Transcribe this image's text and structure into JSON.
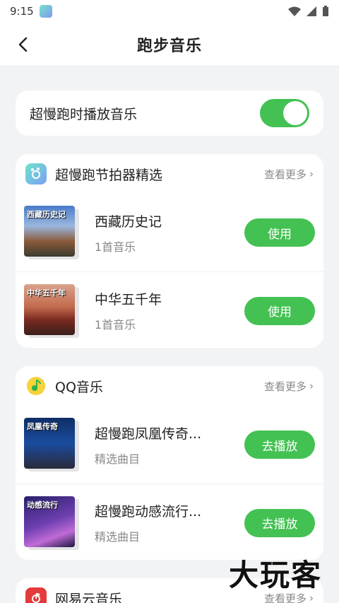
{
  "status_bar": {
    "time": "9:15"
  },
  "header": {
    "title": "跑步音乐"
  },
  "toggle": {
    "label": "超慢跑时播放音乐",
    "on": true,
    "color": "#43c152"
  },
  "sections": [
    {
      "name": "超慢跑节拍器精选",
      "more": "查看更多",
      "items": [
        {
          "title": "西藏历史记",
          "subtitle": "1首音乐",
          "button": "使用",
          "cover_text": "西藏历史记"
        },
        {
          "title": "中华五千年",
          "subtitle": "1首音乐",
          "button": "使用",
          "cover_text": "中华五千年"
        }
      ]
    },
    {
      "name": "QQ音乐",
      "more": "查看更多",
      "items": [
        {
          "title": "超慢跑凤凰传奇...",
          "subtitle": "精选曲目",
          "button": "去播放",
          "cover_text": "凤凰传奇"
        },
        {
          "title": "超慢跑动感流行...",
          "subtitle": "精选曲目",
          "button": "去播放",
          "cover_text": "动感流行"
        }
      ]
    },
    {
      "name": "网易云音乐",
      "more": "查看更多"
    }
  ],
  "watermark": "大玩客"
}
